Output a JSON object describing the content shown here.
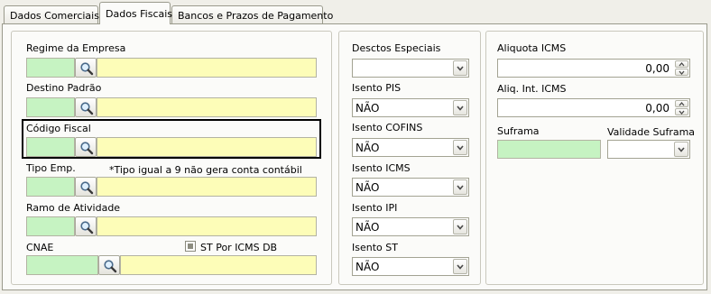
{
  "tabs": [
    {
      "label": "Dados Comerciais",
      "active": false
    },
    {
      "label": "Dados Fiscais",
      "active": true
    },
    {
      "label": "Bancos e Prazos de Pagamento",
      "active": false
    }
  ],
  "left": {
    "regime": {
      "label": "Regime da Empresa",
      "code": "",
      "desc": ""
    },
    "destino": {
      "label": "Destino Padrão",
      "code": "",
      "desc": ""
    },
    "codigo_fiscal": {
      "label": "Código Fiscal",
      "code": "",
      "desc": ""
    },
    "tipo_emp": {
      "label": "Tipo Emp.",
      "note": "*Tipo igual a 9 não gera conta contábil",
      "code": "",
      "desc": ""
    },
    "ramo": {
      "label": "Ramo de Atividade",
      "code": "",
      "desc": ""
    },
    "cnae": {
      "label": "CNAE",
      "code": "",
      "desc": ""
    },
    "st_por_icms_db": {
      "label": "ST Por ICMS DB",
      "state": "indeterminate"
    }
  },
  "middle": {
    "desctos": {
      "label": "Desctos Especiais",
      "value": ""
    },
    "isento_pis": {
      "label": "Isento PIS",
      "value": "NÃO"
    },
    "isento_cofins": {
      "label": "Isento COFINS",
      "value": "NÃO"
    },
    "isento_icms": {
      "label": "Isento ICMS",
      "value": "NÃO"
    },
    "isento_ipi": {
      "label": "Isento IPI",
      "value": "NÃO"
    },
    "isento_st": {
      "label": "Isento ST",
      "value": "NÃO"
    }
  },
  "right": {
    "aliquota_icms": {
      "label": "Aliquota ICMS",
      "value": "0,00"
    },
    "aliq_int_icms": {
      "label": "Aliq. Int. ICMS",
      "value": "0,00"
    },
    "suframa": {
      "label": "Suframa",
      "value": ""
    },
    "validade_suframa": {
      "label": "Validade Suframa",
      "value": ""
    }
  },
  "colors": {
    "code_field": "#c6f3c2",
    "desc_field": "#fdfdb8",
    "focus_border": "#000000"
  },
  "icons": {
    "search": "magnifier-icon",
    "dropdown": "chevron-down-icon",
    "spin_up": "spin-up-icon",
    "spin_down": "spin-down-icon"
  }
}
